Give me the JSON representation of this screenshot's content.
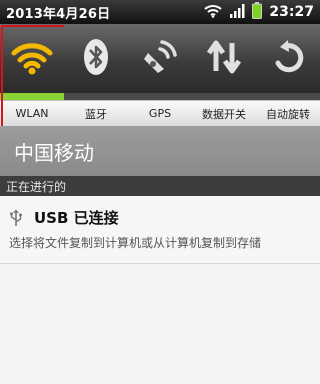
{
  "status_bar": {
    "date": "2013年4月26日",
    "time": "23:27",
    "icons": [
      "wifi-icon",
      "signal-icon",
      "battery-icon"
    ],
    "battery_color": "#7ed321"
  },
  "toggles": [
    {
      "label": "WLAN",
      "icon": "wifi-icon",
      "on": true,
      "selected": true
    },
    {
      "label": "蓝牙",
      "icon": "bluetooth-icon",
      "on": false
    },
    {
      "label": "GPS",
      "icon": "gps-icon",
      "on": false
    },
    {
      "label": "数据开关",
      "icon": "data-toggle-icon",
      "on": false
    },
    {
      "label": "自动旋转",
      "icon": "auto-rotate-icon",
      "on": false
    }
  ],
  "carrier": "中国移动",
  "section_header": "正在进行的",
  "notification": {
    "icon": "usb-icon",
    "title": "USB 已连接",
    "text": "选择将文件复制到计算机或从计算机复制到存储"
  },
  "colors": {
    "active_indicator": "#8ad336",
    "wifi_icon": "#f5b800",
    "selection_outline": "#d4151b"
  }
}
